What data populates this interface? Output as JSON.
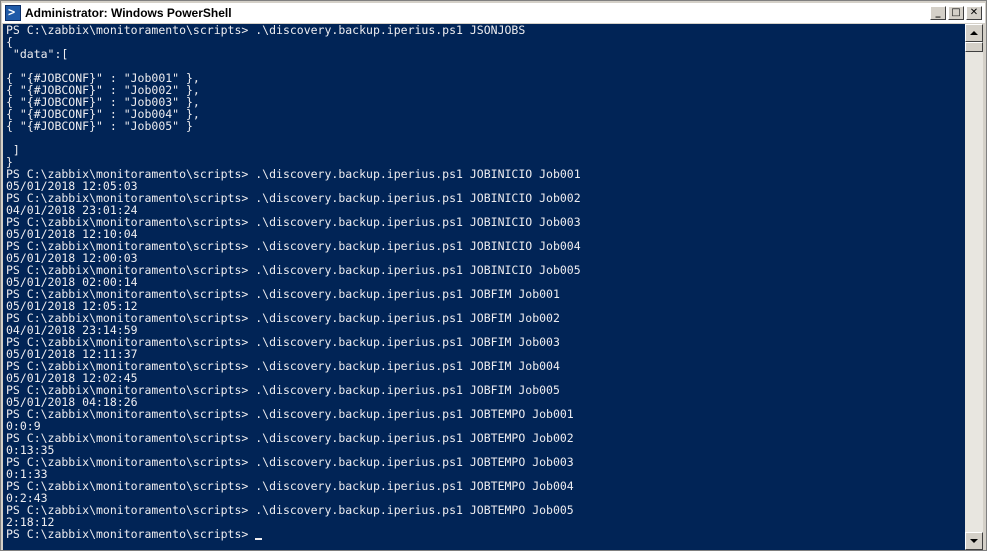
{
  "window": {
    "title": "Administrator: Windows PowerShell",
    "buttons": {
      "minimize": "_",
      "maximize": "□",
      "close": "✕"
    },
    "icon": "powershell-icon"
  },
  "console": {
    "background_color": "#012456",
    "text_color": "#eeedf0",
    "lines": [
      "PS C:\\zabbix\\monitoramento\\scripts> .\\discovery.backup.iperius.ps1 JSONJOBS",
      "{",
      " \"data\":[",
      "",
      "{ \"{#JOBCONF}\" : \"Job001\" },",
      "{ \"{#JOBCONF}\" : \"Job002\" },",
      "{ \"{#JOBCONF}\" : \"Job003\" },",
      "{ \"{#JOBCONF}\" : \"Job004\" },",
      "{ \"{#JOBCONF}\" : \"Job005\" }",
      "",
      " ]",
      "}",
      "PS C:\\zabbix\\monitoramento\\scripts> .\\discovery.backup.iperius.ps1 JOBINICIO Job001",
      "05/01/2018 12:05:03",
      "PS C:\\zabbix\\monitoramento\\scripts> .\\discovery.backup.iperius.ps1 JOBINICIO Job002",
      "04/01/2018 23:01:24",
      "PS C:\\zabbix\\monitoramento\\scripts> .\\discovery.backup.iperius.ps1 JOBINICIO Job003",
      "05/01/2018 12:10:04",
      "PS C:\\zabbix\\monitoramento\\scripts> .\\discovery.backup.iperius.ps1 JOBINICIO Job004",
      "05/01/2018 12:00:03",
      "PS C:\\zabbix\\monitoramento\\scripts> .\\discovery.backup.iperius.ps1 JOBINICIO Job005",
      "05/01/2018 02:00:14",
      "PS C:\\zabbix\\monitoramento\\scripts> .\\discovery.backup.iperius.ps1 JOBFIM Job001",
      "05/01/2018 12:05:12",
      "PS C:\\zabbix\\monitoramento\\scripts> .\\discovery.backup.iperius.ps1 JOBFIM Job002",
      "04/01/2018 23:14:59",
      "PS C:\\zabbix\\monitoramento\\scripts> .\\discovery.backup.iperius.ps1 JOBFIM Job003",
      "05/01/2018 12:11:37",
      "PS C:\\zabbix\\monitoramento\\scripts> .\\discovery.backup.iperius.ps1 JOBFIM Job004",
      "05/01/2018 12:02:45",
      "PS C:\\zabbix\\monitoramento\\scripts> .\\discovery.backup.iperius.ps1 JOBFIM Job005",
      "05/01/2018 04:18:26",
      "PS C:\\zabbix\\monitoramento\\scripts> .\\discovery.backup.iperius.ps1 JOBTEMPO Job001",
      "0:0:9",
      "PS C:\\zabbix\\monitoramento\\scripts> .\\discovery.backup.iperius.ps1 JOBTEMPO Job002",
      "0:13:35",
      "PS C:\\zabbix\\monitoramento\\scripts> .\\discovery.backup.iperius.ps1 JOBTEMPO Job003",
      "0:1:33",
      "PS C:\\zabbix\\monitoramento\\scripts> .\\discovery.backup.iperius.ps1 JOBTEMPO Job004",
      "0:2:43",
      "PS C:\\zabbix\\monitoramento\\scripts> .\\discovery.backup.iperius.ps1 JOBTEMPO Job005",
      "2:18:12"
    ],
    "prompt": "PS C:\\zabbix\\monitoramento\\scripts>"
  },
  "scrollbar": {
    "up_icon": "arrow-up-icon",
    "down_icon": "arrow-down-icon"
  }
}
